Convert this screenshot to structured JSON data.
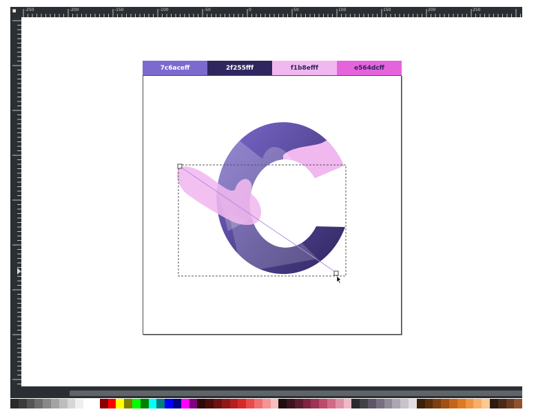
{
  "rulers": {
    "corner_glyph": "◼",
    "top_labels": [
      "-250",
      "-200",
      "-150",
      "-100",
      "-50",
      "0",
      "50",
      "100",
      "150",
      "200",
      "250"
    ],
    "left_labels": [
      "50",
      "100",
      "150",
      "200",
      "250",
      "300",
      "350",
      "400",
      "450",
      "500",
      "550"
    ]
  },
  "swatches": [
    {
      "label": "7c6aceff",
      "bg": "#7c6ace",
      "fg": "#ffffff"
    },
    {
      "label": "2f255fff",
      "bg": "#2f255f",
      "fg": "#ffffff"
    },
    {
      "label": "f1b8efff",
      "bg": "#f1b8ef",
      "fg": "#2f255f"
    },
    {
      "label": "e564dcff",
      "bg": "#e564dc",
      "fg": "#2f255f"
    }
  ],
  "artwork": {
    "subject": "letter-c-logo",
    "gradient_from": "#7c6ace",
    "gradient_to": "#2f255f",
    "splash_color": "#f1b8ef",
    "tool": "gradient-tool",
    "selection": "dashed-bounding-box"
  },
  "palette": [
    "#2a2a2a",
    "#3c3c3c",
    "#555555",
    "#6e6e6e",
    "#888888",
    "#a3a3a3",
    "#bdbdbd",
    "#d6d6d6",
    "#efefef",
    "#ffffff",
    "#ffffff",
    "#8b0000",
    "#ff0000",
    "#ffff00",
    "#808000",
    "#00ff00",
    "#008000",
    "#00ffff",
    "#008080",
    "#0000ff",
    "#000080",
    "#ff00ff",
    "#800080",
    "#2d0a0a",
    "#4a0d0d",
    "#6b1212",
    "#8f1818",
    "#b51f1f",
    "#d42a2a",
    "#e84a4a",
    "#f06e6e",
    "#f59494",
    "#f9bcbc",
    "#1f0d12",
    "#3b1420",
    "#5c1c30",
    "#7d2642",
    "#9e3355",
    "#bb4a6b",
    "#cf6b86",
    "#e090a5",
    "#eeb8c6",
    "#2a2a2e",
    "#444048",
    "#5e5664",
    "#786e80",
    "#928a9a",
    "#aca6b2",
    "#c8c2cc",
    "#e2dde4",
    "#3d1f0a",
    "#5c2e0d",
    "#7d3e10",
    "#a05014",
    "#c46418",
    "#de7a22",
    "#ef9440",
    "#f7ae66",
    "#fbc890",
    "#2e1a10",
    "#4a2a18",
    "#6b3c22",
    "#8f522e"
  ]
}
